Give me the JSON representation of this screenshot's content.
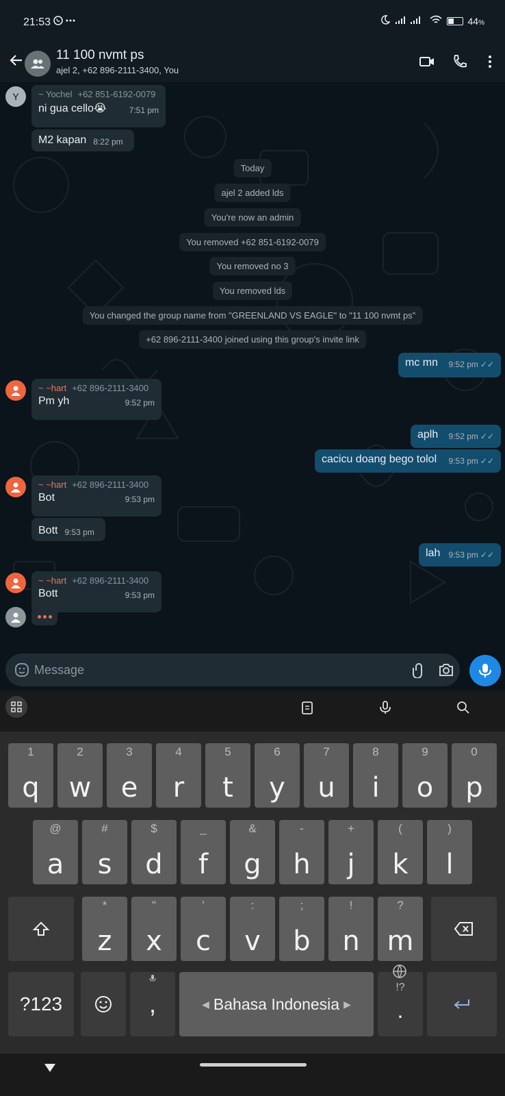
{
  "status_bar": {
    "time": "21:53",
    "battery": "44",
    "battery_unit": "%",
    "battery_level": 0.44
  },
  "header": {
    "title": "11 100 nvmt ps",
    "subtitle": "ajel 2, +62 896-2111-3400, You"
  },
  "messages": {
    "m1": {
      "avatar_letter": "Y",
      "sender": "~ Yochel",
      "phone": "+62 851-6192-0079",
      "text": "ni gua cello😭",
      "time": "7:51 pm"
    },
    "m2": {
      "text": "M2 kapan",
      "time": "8:22 pm"
    },
    "s_today": "Today",
    "s1": "ajel 2 added lds",
    "s2": "You're now an admin",
    "s3": "You removed +62 851-6192-0079",
    "s4": "You removed no 3",
    "s5": "You removed lds",
    "s6": "You changed the group name from \"GREENLAND VS EAGLE\" to \"11 100 nvmt ps\"",
    "s7": "+62 896-2111-3400 joined using this group's invite link",
    "o1": {
      "text": "mc mn",
      "time": "9:52 pm"
    },
    "m3": {
      "sender": "~ ~hart",
      "phone": "+62 896-2111-3400",
      "text": "Pm yh",
      "time": "9:52 pm"
    },
    "o2": {
      "text": "aplh",
      "time": "9:52 pm"
    },
    "o3": {
      "text": "cacicu doang bego tolol",
      "time": "9:53 pm"
    },
    "m4": {
      "sender": "~ ~hart",
      "phone": "+62 896-2111-3400",
      "text": "Bot",
      "time": "9:53 pm"
    },
    "m5": {
      "text": "Bott",
      "time": "9:53 pm"
    },
    "o4": {
      "text": "lah",
      "time": "9:53 pm"
    },
    "m6": {
      "sender": "~ ~hart",
      "phone": "+62 896-2111-3400",
      "text": "Bott",
      "time": "9:53 pm"
    }
  },
  "input": {
    "placeholder": "Message"
  },
  "keyboard": {
    "row1": [
      {
        "hint": "1",
        "key": "q"
      },
      {
        "hint": "2",
        "key": "w"
      },
      {
        "hint": "3",
        "key": "e"
      },
      {
        "hint": "4",
        "key": "r"
      },
      {
        "hint": "5",
        "key": "t"
      },
      {
        "hint": "6",
        "key": "y"
      },
      {
        "hint": "7",
        "key": "u"
      },
      {
        "hint": "8",
        "key": "i"
      },
      {
        "hint": "9",
        "key": "o"
      },
      {
        "hint": "0",
        "key": "p"
      }
    ],
    "row2": [
      {
        "hint": "@",
        "key": "a"
      },
      {
        "hint": "#",
        "key": "s"
      },
      {
        "hint": "$",
        "key": "d"
      },
      {
        "hint": "_",
        "key": "f"
      },
      {
        "hint": "&",
        "key": "g"
      },
      {
        "hint": "-",
        "key": "h"
      },
      {
        "hint": "+",
        "key": "j"
      },
      {
        "hint": "(",
        "key": "k"
      },
      {
        "hint": ")",
        "key": "l"
      }
    ],
    "row3": [
      {
        "hint": "*",
        "key": "z"
      },
      {
        "hint": "\"",
        "key": "x"
      },
      {
        "hint": "'",
        "key": "c"
      },
      {
        "hint": ":",
        "key": "v"
      },
      {
        "hint": ";",
        "key": "b"
      },
      {
        "hint": "!",
        "key": "n"
      },
      {
        "hint": "?",
        "key": "m"
      }
    ],
    "symbols_label": "?123",
    "comma": ",",
    "space_label": "Bahasa Indonesia",
    "period": ".",
    "period_hint": "!?"
  }
}
